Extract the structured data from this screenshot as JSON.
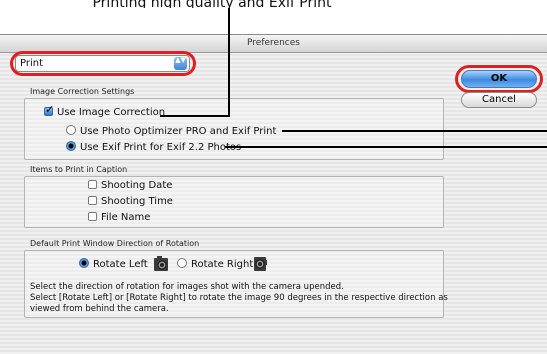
{
  "annotation": {
    "top_caption": "Printing high quality and Exif Print"
  },
  "window": {
    "title": "Preferences"
  },
  "popup": {
    "selected": "Print",
    "arrows": "▲▼"
  },
  "buttons": {
    "ok": "OK",
    "cancel": "Cancel"
  },
  "image_correction": {
    "title": "Image Correction Settings",
    "use_image_correction": "Use Image Correction",
    "option_optimizer": "Use Photo Optimizer PRO and Exif Print",
    "option_exif": "Use Exif Print for Exif 2.2 Photos"
  },
  "caption_items": {
    "title": "Items to Print in Caption",
    "shooting_date": "Shooting Date",
    "shooting_time": "Shooting Time",
    "file_name": "File Name"
  },
  "rotation": {
    "title": "Default Print Window Direction of Rotation",
    "rotate_left": "Rotate Left",
    "rotate_right": "Rotate Right",
    "help_line1": "Select the direction of rotation for images shot with the camera upended.",
    "help_line2": "Select [Rotate Left] or [Rotate Right] to rotate the image 90 degrees in the respective direction as viewed from behind the camera."
  },
  "colors": {
    "callout_ring": "#e02020",
    "aqua_blue": "#3d8be0"
  }
}
